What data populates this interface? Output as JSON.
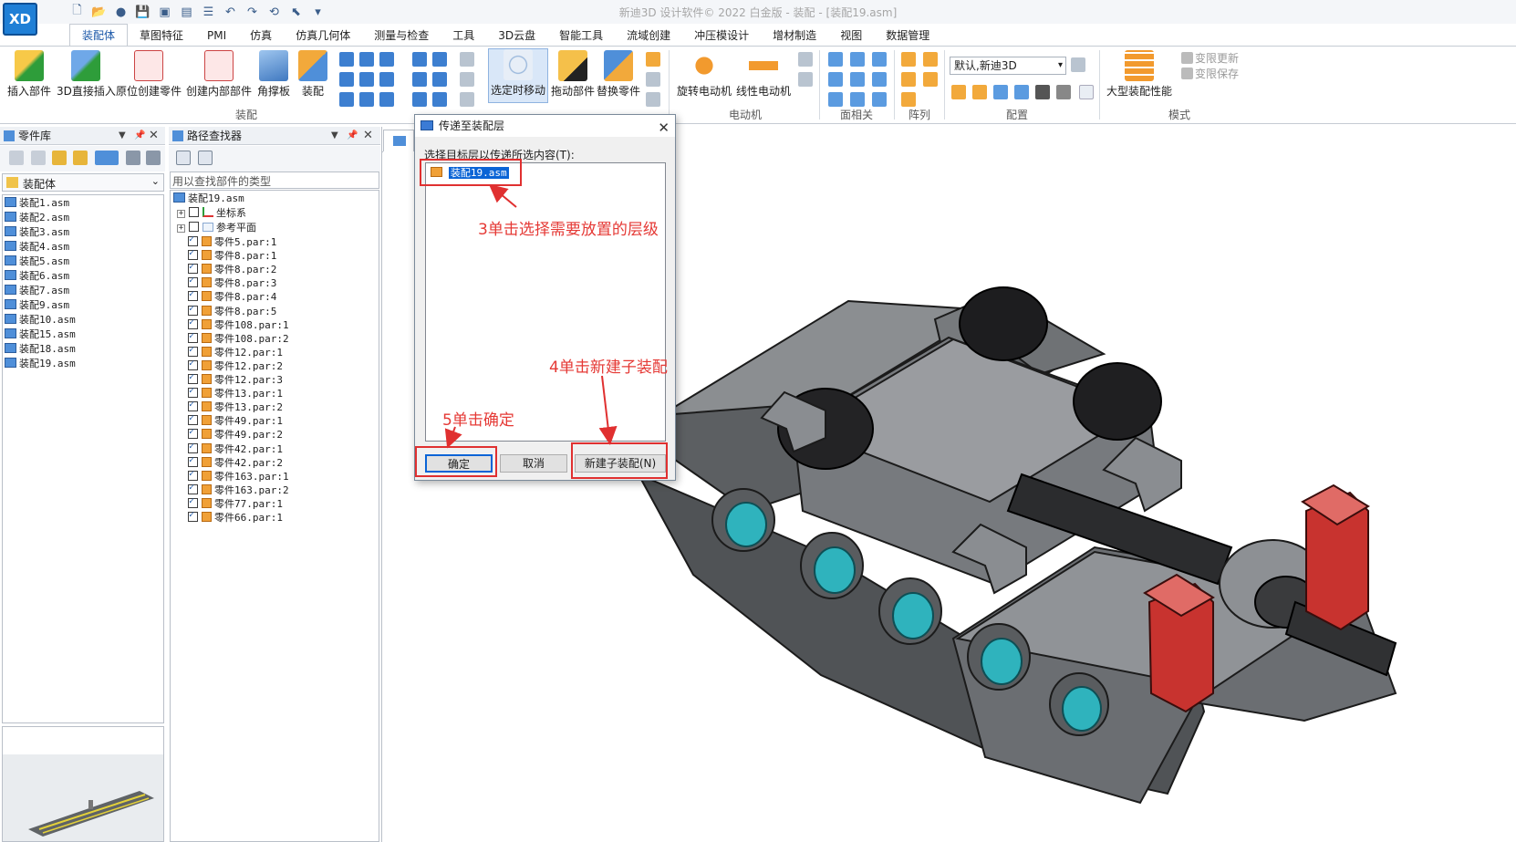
{
  "window": {
    "title": "新迪3D 设计软件© 2022 白金版 - 装配 - [装配19.asm]"
  },
  "app": {
    "logo": "XD"
  },
  "ribbon_tabs": [
    "装配体",
    "草图特征",
    "PMI",
    "仿真",
    "仿真几何体",
    "测量与检查",
    "工具",
    "3D云盘",
    "智能工具",
    "流域创建",
    "冲压模设计",
    "增材制造",
    "视图",
    "数据管理"
  ],
  "ribbon": {
    "insert_part": "插入部件",
    "direct_insert_3d": "3D直接插入",
    "create_in_place": "原位创建零件",
    "create_inner_part": "创建内部部件",
    "angle_plate": "角撑板",
    "assemble": "装配",
    "group_assembly": "装配",
    "move_selected": "选定时移动",
    "drag_part": "拖动部件",
    "replace_part": "替换零件",
    "rotary_motor": "旋转电动机",
    "linear_motor": "线性电动机",
    "group_motor": "电动机",
    "group_face_relate": "面相关",
    "group_array": "阵列",
    "config_value": "默认,新迪3D",
    "group_config": "配置",
    "large_asm": "大型装配性能",
    "var_update": "变限更新",
    "var_save": "变限保存",
    "group_mode": "模式"
  },
  "parts_library": {
    "title": "零件库",
    "folder": "装配体",
    "items": [
      "装配1.asm",
      "装配2.asm",
      "装配3.asm",
      "装配4.asm",
      "装配5.asm",
      "装配6.asm",
      "装配7.asm",
      "装配9.asm",
      "装配10.asm",
      "装配15.asm",
      "装配18.asm",
      "装配19.asm"
    ]
  },
  "path_finder": {
    "title": "路径查找器",
    "search_placeholder": "用以查找部件的类型",
    "root": "装配19.asm",
    "coord_system": "坐标系",
    "ref_planes": "参考平面",
    "parts": [
      "零件5.par:1",
      "零件8.par:1",
      "零件8.par:2",
      "零件8.par:3",
      "零件8.par:4",
      "零件8.par:5",
      "零件108.par:1",
      "零件108.par:2",
      "零件12.par:1",
      "零件12.par:2",
      "零件12.par:3",
      "零件13.par:1",
      "零件13.par:2",
      "零件49.par:1",
      "零件49.par:2",
      "零件42.par:1",
      "零件42.par:2",
      "零件163.par:1",
      "零件163.par:2",
      "零件77.par:1",
      "零件66.par:1"
    ]
  },
  "dialog": {
    "title": "传递至装配层",
    "prompt": "选择目标层以传递所选内容(T):",
    "selected_item": "装配19.asm",
    "ok": "确定",
    "cancel": "取消",
    "new_subassembly": "新建子装配(N)"
  },
  "annotations": {
    "step3": "3单击选择需要放置的层级",
    "step4": "4单击新建子装配",
    "step5": "5单击确定"
  },
  "colors": {
    "accent": "#1a57a8",
    "annotation": "#e53935",
    "part_gray": "#7d7f82",
    "bushing": "#2fb3bd",
    "pin_red": "#c8332f"
  }
}
